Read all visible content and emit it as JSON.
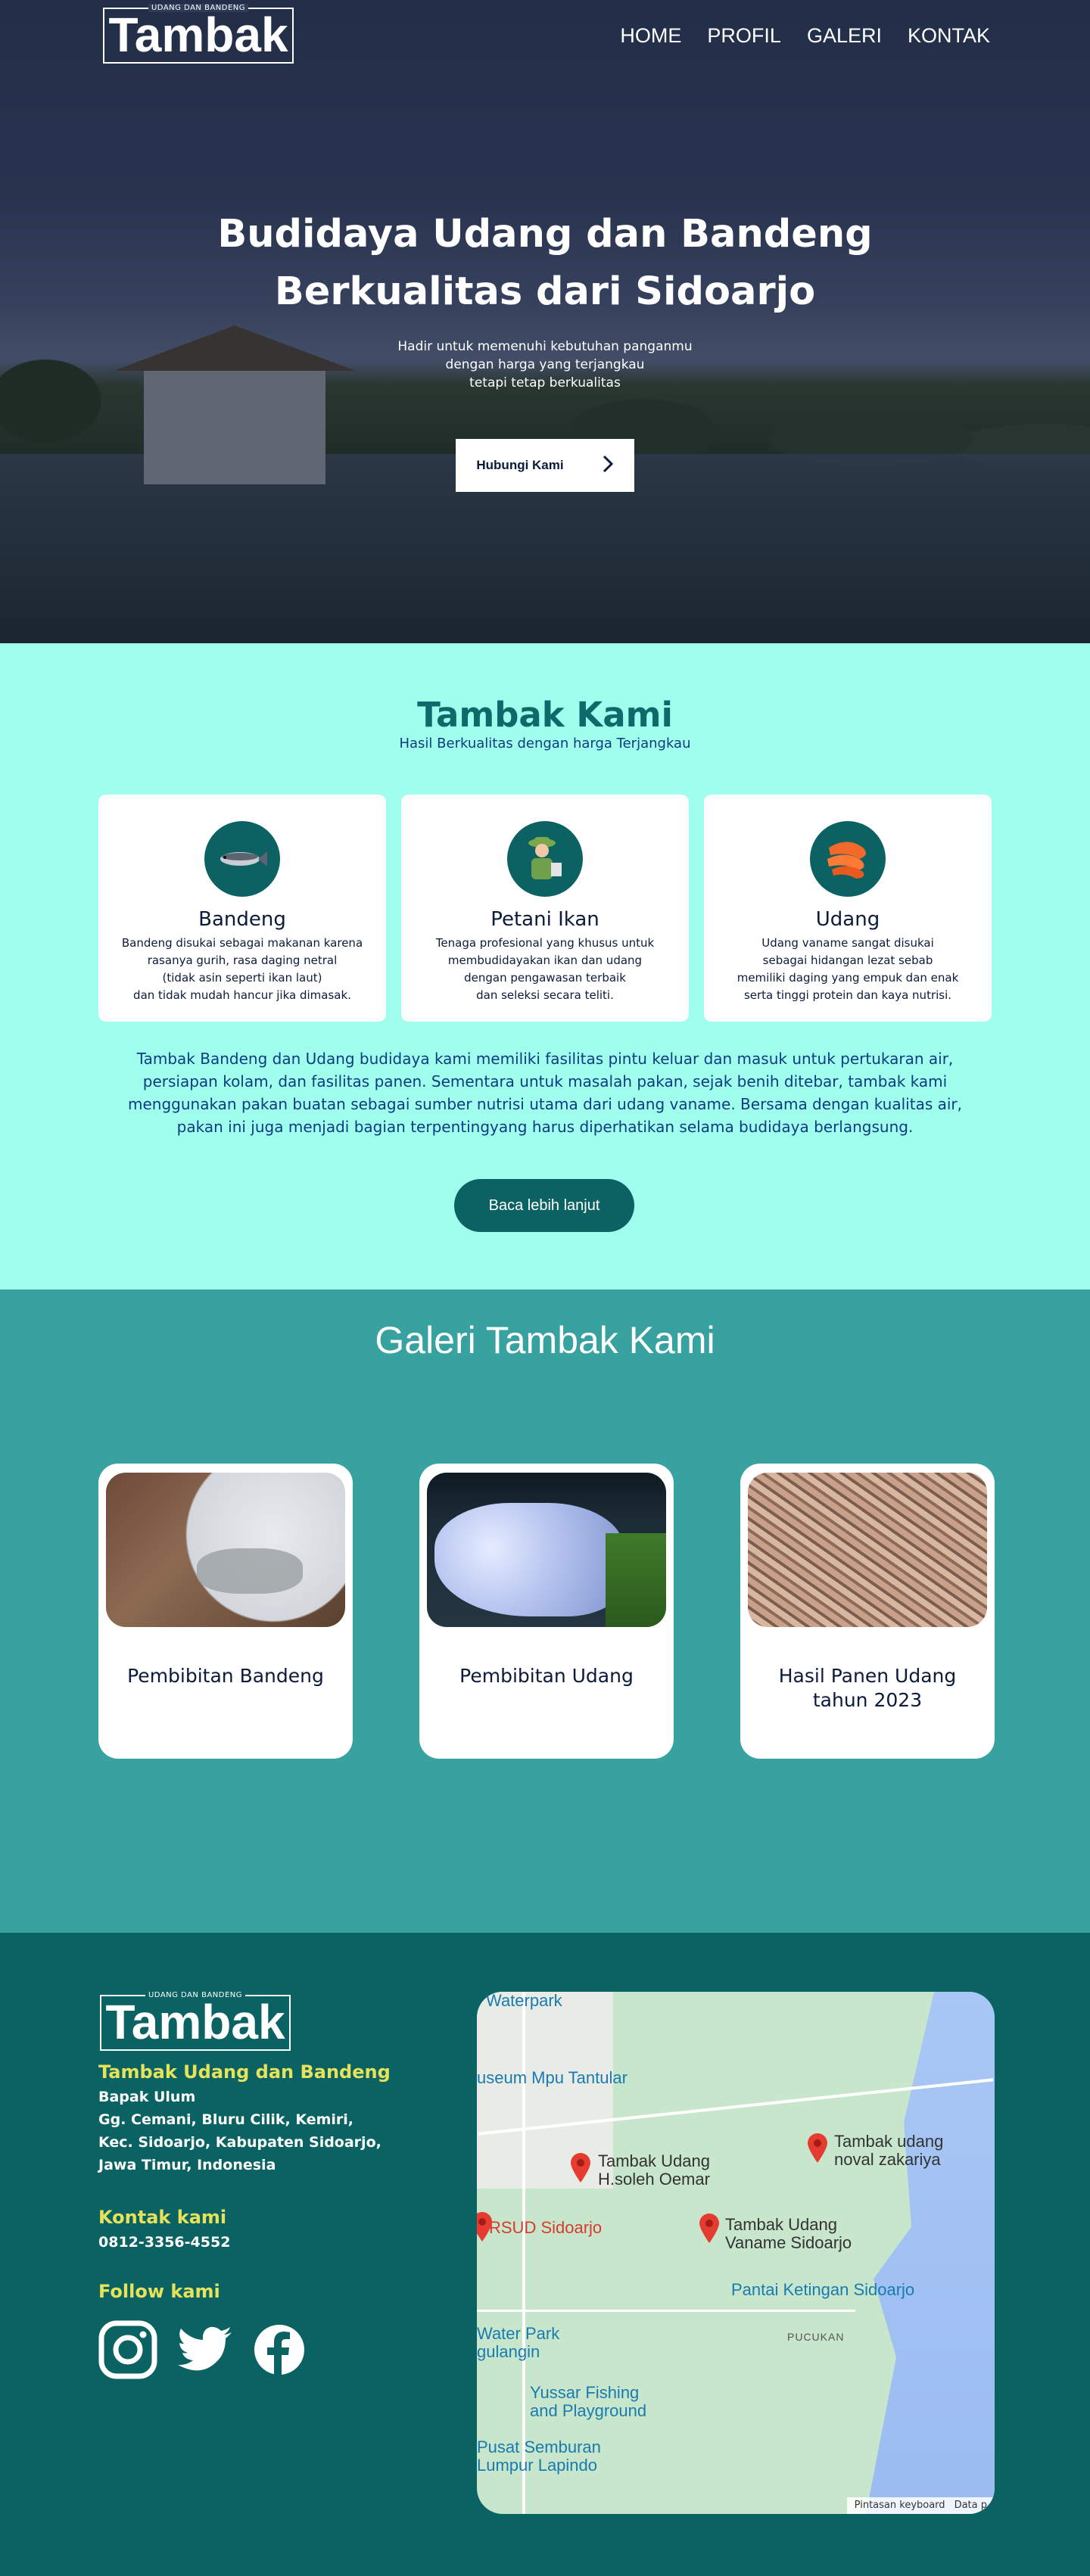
{
  "brand": {
    "tagline": "UDANG DAN BANDENG",
    "name": "Tambak"
  },
  "nav": [
    "HOME",
    "PROFIL",
    "GALERI",
    "KONTAK"
  ],
  "hero": {
    "title_line1": "Budidaya Udang dan Bandeng",
    "title_line2": "Berkualitas dari Sidoarjo",
    "subtitle": "Hadir untuk memenuhi kebutuhan panganmu\ndengan harga yang terjangkau\ntetapi tetap berkualitas",
    "cta": "Hubungi Kami"
  },
  "about": {
    "title": "Tambak Kami",
    "subtitle": "Hasil Berkualitas dengan harga Terjangkau",
    "cards": [
      {
        "icon": "fish-icon",
        "name": "Bandeng",
        "desc": "Bandeng disukai sebagai makanan karena\nrasanya gurih, rasa daging netral\n(tidak asin seperti ikan laut)\ndan tidak mudah hancur jika dimasak."
      },
      {
        "icon": "farmer-icon",
        "name": "Petani Ikan",
        "desc": "Tenaga profesional yang khusus untuk\nmembudidayakan ikan dan udang\ndengan pengawasan terbaik\ndan seleksi secara teliti."
      },
      {
        "icon": "shrimp-icon",
        "name": "Udang",
        "desc": "Udang vaname sangat disukai\nsebagai hidangan lezat sebab\nmemiliki daging yang empuk dan enak\nserta tinggi protein dan kaya nutrisi."
      }
    ],
    "paragraph": "Tambak Bandeng dan Udang budidaya kami memiliki fasilitas pintu keluar dan masuk untuk pertukaran air, persiapan kolam, dan fasilitas panen. Sementara untuk masalah pakan, sejak benih ditebar,  tambak kami menggunakan pakan buatan sebagai sumber nutrisi utama dari udang vaname. Bersama dengan kualitas air, pakan ini juga menjadi bagian terpentingyang harus diperhatikan selama budidaya berlangsung.",
    "button": "Baca lebih lanjut"
  },
  "gallery": {
    "title": "Galeri Tambak Kami",
    "items": [
      {
        "caption": "Pembibitan Bandeng"
      },
      {
        "caption": "Pembibitan Udang"
      },
      {
        "caption": "Hasil Panen Udang\ntahun 2023"
      }
    ]
  },
  "footer": {
    "company": "Tambak Udang dan Bandeng",
    "owner": "Bapak Ulum",
    "address": "Gg. Cemani, Bluru Cilik, Kemiri,\nKec. Sidoarjo, Kabupaten Sidoarjo,\nJawa Timur, Indonesia",
    "contact_heading": "Kontak kami",
    "phone": "0812-3356-4552",
    "follow_heading": "Follow kami",
    "socials": [
      "instagram-icon",
      "twitter-icon",
      "facebook-icon"
    ]
  },
  "map": {
    "labels": {
      "waterpark": "Waterpark",
      "museum": "useum Mpu Tantular",
      "tambak1": "Tambak Udang\nH.soleh Oemar",
      "tambak2": "Tambak udang\nnoval zakariya",
      "rsud": "RSUD Sidoarjo",
      "tambak3": "Tambak Udang\nVaname Sidoarjo",
      "pantai": "Pantai Ketingan Sidoarjo",
      "pucukan": "PUCUKAN",
      "waterpark2": "Water Park\ngulangin",
      "yussar": "Yussar Fishing\nand Playground",
      "lapindo": "Pusat Semburan\nLumpur Lapindo",
      "shortcut": "Pintasan keyboard",
      "data": "Data p"
    },
    "colors": {
      "pin": "#e53b30",
      "land": "#c7e6cc",
      "sea": "#a8c7f5"
    }
  },
  "colors": {
    "about_bg": "#9ffeec",
    "gallery_bg": "#37a29f",
    "footer_bg": "#0b6262",
    "accent_yellow": "#e6e35a"
  }
}
